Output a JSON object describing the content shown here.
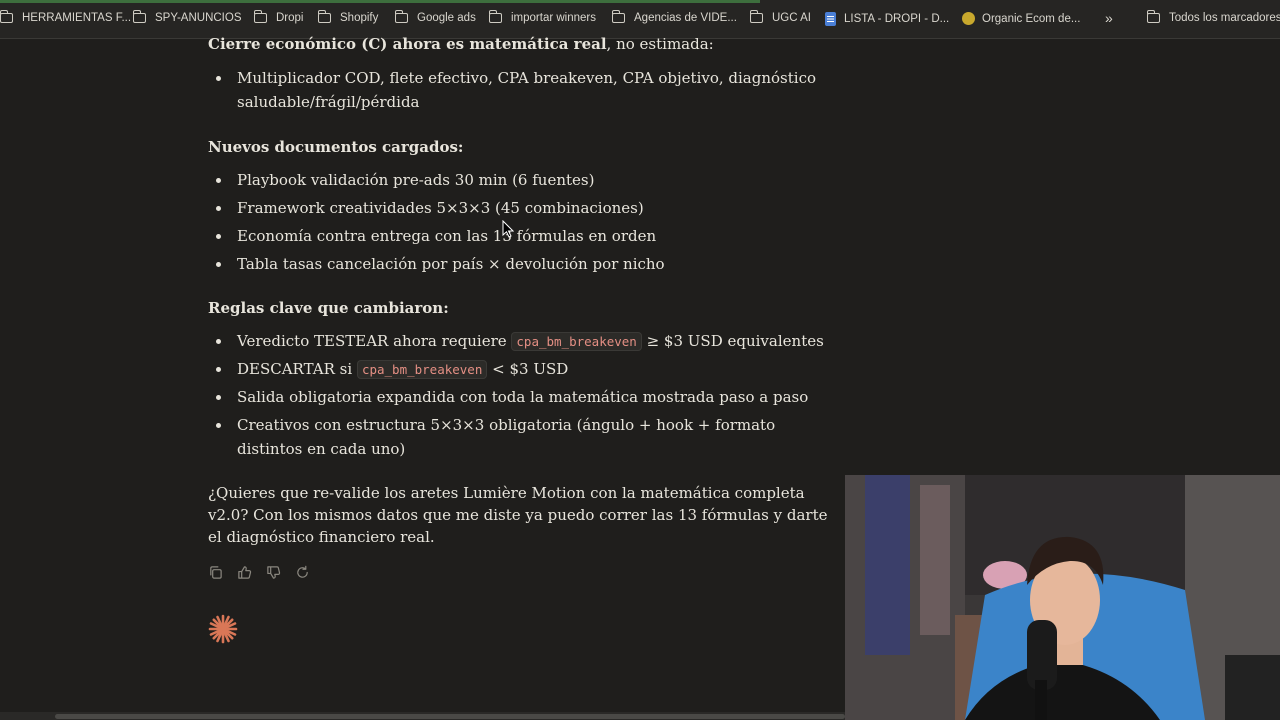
{
  "bookmarks": [
    {
      "label": "HERRAMIENTAS F...",
      "icon": "folder-icon"
    },
    {
      "label": "SPY-ANUNCIOS",
      "icon": "folder-icon"
    },
    {
      "label": "Dropi",
      "icon": "folder-icon"
    },
    {
      "label": "Shopify",
      "icon": "folder-icon"
    },
    {
      "label": "Google ads",
      "icon": "folder-icon"
    },
    {
      "label": "importar winners",
      "icon": "folder-icon"
    },
    {
      "label": "Agencias de VIDE...",
      "icon": "folder-icon"
    },
    {
      "label": "UGC AI",
      "icon": "folder-icon"
    },
    {
      "label": "LISTA - DROPI - D...",
      "icon": "google-docs-icon"
    },
    {
      "label": "Organic Ecom de...",
      "icon": "site-favicon-icon"
    },
    {
      "label": "Todos los marcadores",
      "icon": "folder-icon"
    }
  ],
  "bookmarks_overflow": "»",
  "message": {
    "cierre": {
      "bold": "Cierre económico (C) ahora es matemática real",
      "rest": ", no estimada:"
    },
    "cierre_items": [
      "Multiplicador COD, flete efectivo, CPA breakeven, CPA objetivo, diagnóstico saludable/frágil/pérdida"
    ],
    "docs_heading": "Nuevos documentos cargados:",
    "docs_items": [
      "Playbook validación pre-ads 30 min (6 fuentes)",
      "Framework creatividades 5×3×3 (45 combinaciones)",
      "Economía contra entrega con las 13 fórmulas en orden",
      "Tabla tasas cancelación por país × devolución por nicho"
    ],
    "rules_heading": "Reglas clave que cambiaron:",
    "rule1": {
      "before": "Veredicto TESTEAR ahora requiere ",
      "code": "cpa_bm_breakeven",
      "after": " ≥ $3 USD equivalentes"
    },
    "rule2": {
      "before": "DESCARTAR si ",
      "code": "cpa_bm_breakeven",
      "after": " < $3 USD"
    },
    "rule3": "Salida obligatoria expandida con toda la matemática mostrada paso a paso",
    "rule4": "Creativos con estructura 5×3×3 obligatoria (ángulo + hook + formato distintos en cada uno)",
    "question": "¿Quieres que re-valide los aretes Lumière Motion con la matemática completa v2.0? Con los mismos datos que me diste ya puedo correr las 13 fórmulas y darte el diagnóstico financiero real."
  },
  "actions": [
    "copy-icon",
    "thumbs-up-icon",
    "thumbs-down-icon",
    "retry-icon"
  ],
  "colors": {
    "background": "#1f1e1c",
    "text": "#e8e5dc",
    "code": "#e48f84",
    "spark": "#d97757"
  }
}
